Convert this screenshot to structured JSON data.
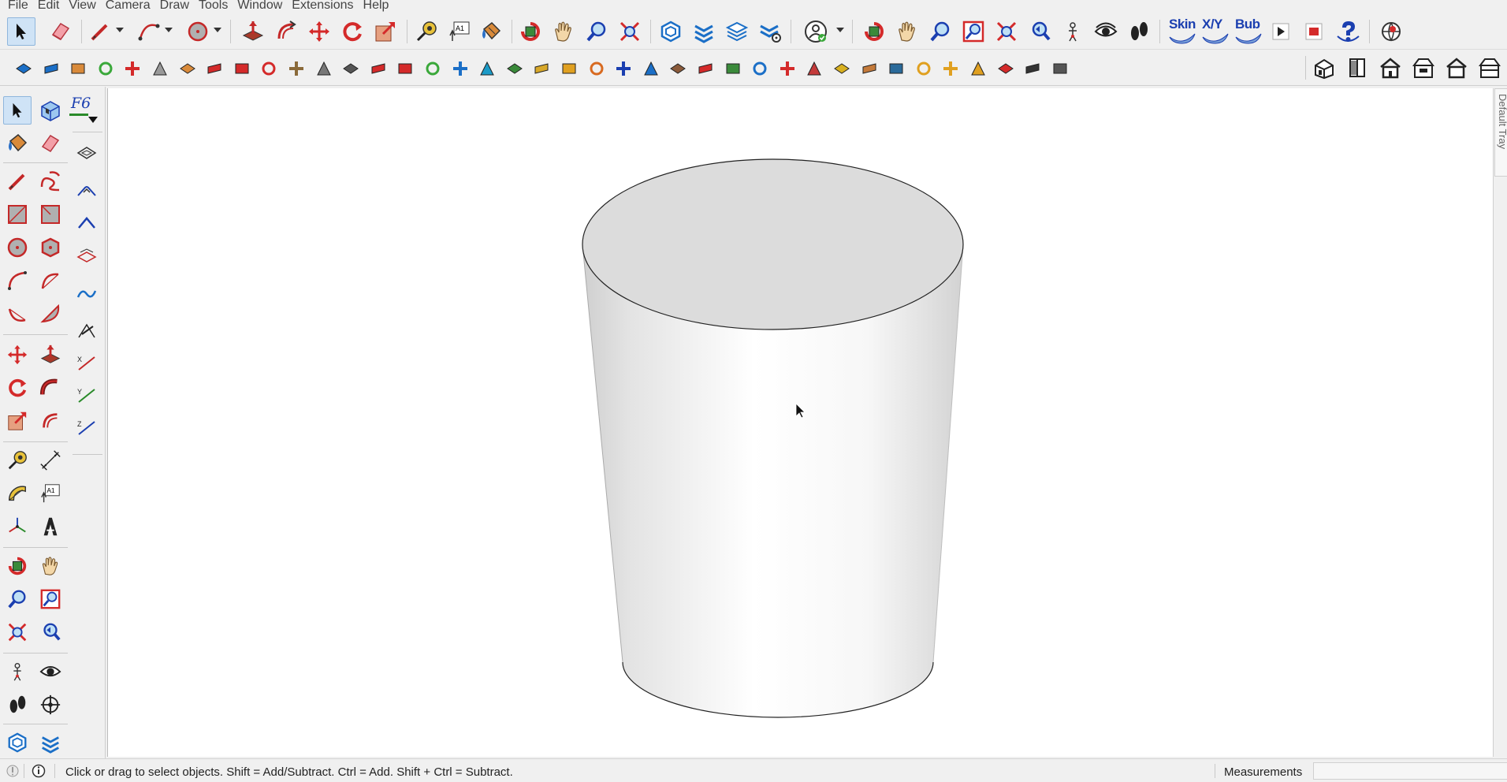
{
  "menu": [
    "File",
    "Edit",
    "View",
    "Camera",
    "Draw",
    "Tools",
    "Window",
    "Extensions",
    "Help"
  ],
  "toolbar": {
    "ext_buttons": [
      "Skin",
      "X/Y",
      "Bub"
    ],
    "font_tool_label": "F6",
    "text_tool_label": "A1"
  },
  "viewport": {
    "model": "cylinder",
    "face_color": "#dcdcdc"
  },
  "tray": {
    "label": "Default Tray"
  },
  "status": {
    "hint": "Click or drag to select objects. Shift = Add/Subtract. Ctrl = Add. Shift + Ctrl = Subtract.",
    "measurements_label": "Measurements",
    "measurements_value": ""
  },
  "colors": {
    "accent_red": "#d42a2a",
    "accent_blue": "#1b6fc7",
    "selected_bg": "#cfe3f6"
  }
}
